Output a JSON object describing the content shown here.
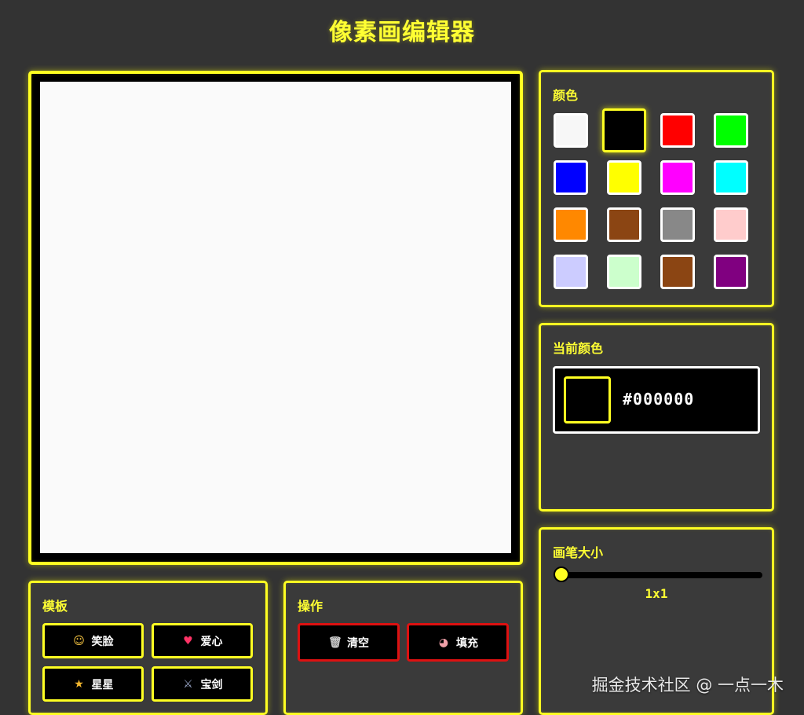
{
  "header": {
    "title": "像素画编辑器"
  },
  "palette": {
    "title": "颜色",
    "selected_index": 1,
    "colors": [
      "#f7f7f7",
      "#000000",
      "#ff0000",
      "#00ff00",
      "#0000ff",
      "#ffff00",
      "#ff00ff",
      "#00ffff",
      "#ff8800",
      "#8b4513",
      "#888888",
      "#ffcccc",
      "#ccccff",
      "#ccffcc",
      "#8b4513",
      "#800080"
    ]
  },
  "current_color": {
    "title": "当前颜色",
    "hex": "#000000"
  },
  "brush": {
    "title": "画笔大小",
    "value_label": "1x1",
    "level": 0
  },
  "templates": {
    "title": "模板",
    "buttons": [
      {
        "icon": "smiley-icon",
        "glyph": "☺",
        "label": "笑脸"
      },
      {
        "icon": "heart-icon",
        "glyph": "♥",
        "label": "爱心"
      },
      {
        "icon": "star-icon",
        "glyph": "★",
        "label": "星星"
      },
      {
        "icon": "sword-icon",
        "glyph": "⚔",
        "label": "宝剑"
      }
    ]
  },
  "operations": {
    "title": "操作",
    "buttons": [
      {
        "icon": "trash-icon",
        "glyph": "🗑",
        "label": "清空"
      },
      {
        "icon": "palette-icon",
        "glyph": "◕",
        "label": "填充"
      }
    ]
  },
  "watermark": "掘金技术社区 @ 一点一木"
}
